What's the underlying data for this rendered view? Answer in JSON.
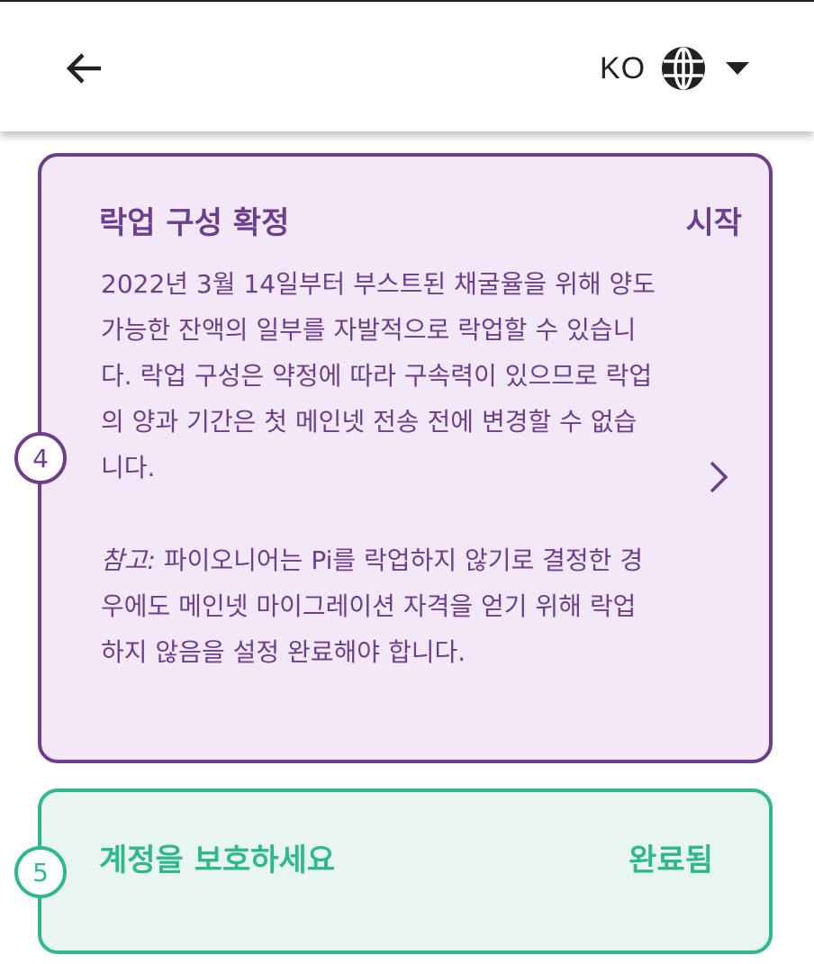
{
  "header": {
    "back_icon": "arrow-left-icon",
    "language": {
      "code": "KO",
      "icon": "globe-icon",
      "dropdown_icon": "caret-down-icon"
    }
  },
  "steps": [
    {
      "number": "4",
      "title": "락업 구성 확정",
      "status": "시작",
      "description": "2022년 3월 14일부터 부스트된 채굴율을 위해 양도 가능한 잔액의 일부를 자발적으로 락업할 수 있습니다. 락업 구성은 약정에 따라 구속력이 있으므로 락업의 양과 기간은 첫 메인넷 전송 전에 변경할 수 없습니다.",
      "note_label": "참고:",
      "note_text": " 파이오니어는 Pi를 락업하지 않기로 결정한 경우에도 메인넷 마이그레이션 자격을 얻기 위해 락업하지 않음을 설정 완료해야 합니다.",
      "color": "#6c3e8d",
      "background": "#f3e8f8",
      "action_icon": "chevron-right-icon"
    },
    {
      "number": "5",
      "title": "계정을 보호하세요",
      "status": "완료됨",
      "color": "#2fb88a",
      "background": "#e9f6ef"
    }
  ]
}
